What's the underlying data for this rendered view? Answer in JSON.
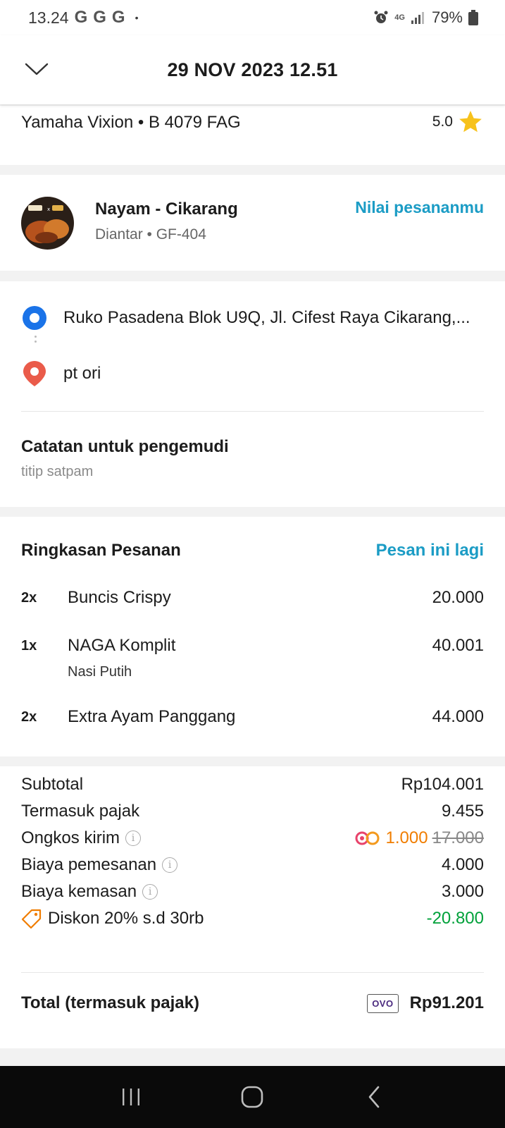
{
  "status_bar": {
    "time": "13.24",
    "notif_icons": [
      "G",
      "G",
      "G"
    ],
    "dot": "•",
    "network": "4G",
    "battery": "79%"
  },
  "header": {
    "title": "29 NOV 2023 12.51"
  },
  "vehicle": {
    "name": "Yamaha Vixion • B 4079 FAG",
    "rating": "5.0"
  },
  "restaurant": {
    "name": "Nayam - Cikarang",
    "subtitle": "Diantar • GF-404",
    "rate_label": "Nilai pesananmu"
  },
  "route": {
    "pickup": "Ruko Pasadena Blok U9Q, Jl. Cifest Raya Cikarang,...",
    "dropoff": "pt ori"
  },
  "driver_note": {
    "title": "Catatan untuk pengemudi",
    "text": "titip satpam"
  },
  "summary": {
    "title": "Ringkasan Pesanan",
    "reorder_label": "Pesan ini lagi",
    "items": [
      {
        "qty": "2x",
        "name": "Buncis Crispy",
        "note": "",
        "price": "20.000"
      },
      {
        "qty": "1x",
        "name": "NAGA Komplit",
        "note": "Nasi Putih",
        "price": "40.001"
      },
      {
        "qty": "2x",
        "name": "Extra Ayam Panggang",
        "note": "",
        "price": "44.000"
      }
    ]
  },
  "fees": {
    "subtotal_label": "Subtotal",
    "subtotal": "Rp104.001",
    "tax_label": "Termasuk pajak",
    "tax": "9.455",
    "delivery_label": "Ongkos kirim",
    "delivery_discounted": "1.000",
    "delivery_original": "17.000",
    "order_fee_label": "Biaya pemesanan",
    "order_fee": "4.000",
    "packaging_label": "Biaya kemasan",
    "packaging": "3.000",
    "discount_label": "Diskon 20% s.d 30rb",
    "discount": "-20.800",
    "total_label": "Total (termasuk pajak)",
    "payment_method": "OVO",
    "total": "Rp91.201"
  },
  "colors": {
    "link": "#1b9cc5",
    "discount": "#00a13a",
    "promo": "#f07d00",
    "star": "#f7c21c"
  }
}
